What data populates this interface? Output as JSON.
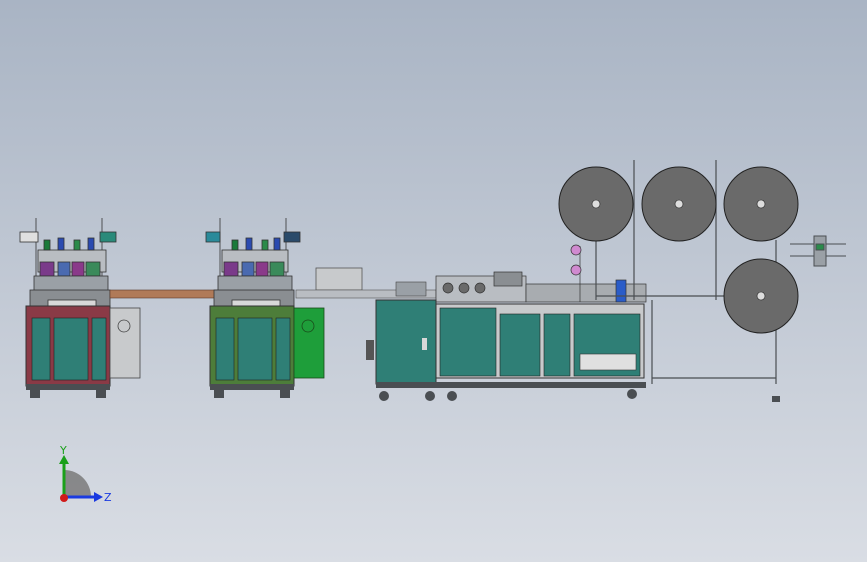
{
  "viewport": {
    "background_top": "#a9b4c4",
    "background_bottom": "#d9dde4"
  },
  "colors": {
    "frame_gray": "#a8acb0",
    "frame_dark": "#4a4e52",
    "cabinet_teal": "#2f7f76",
    "cabinet_green_door": "#1e9e3a",
    "machine1_frame": "#8a3a46",
    "machine2_frame": "#4d7d3a",
    "conveyor_brown": "#b07a58",
    "roll_gray": "#6a6a6a",
    "purple_part": "#7a3a8a",
    "blue_part": "#2a5cc8"
  },
  "triad": {
    "y_label": "Y",
    "z_label": "Z",
    "y_color": "#1aa01a",
    "z_color": "#1a3ae0",
    "x_color": "#d01a1a",
    "hub_color": "#7a7a7a"
  },
  "icons": {
    "material_roll": "material-roll-icon",
    "door_handle": "door-handle-icon",
    "caster": "caster-wheel-icon",
    "control_panel": "control-panel-icon"
  }
}
